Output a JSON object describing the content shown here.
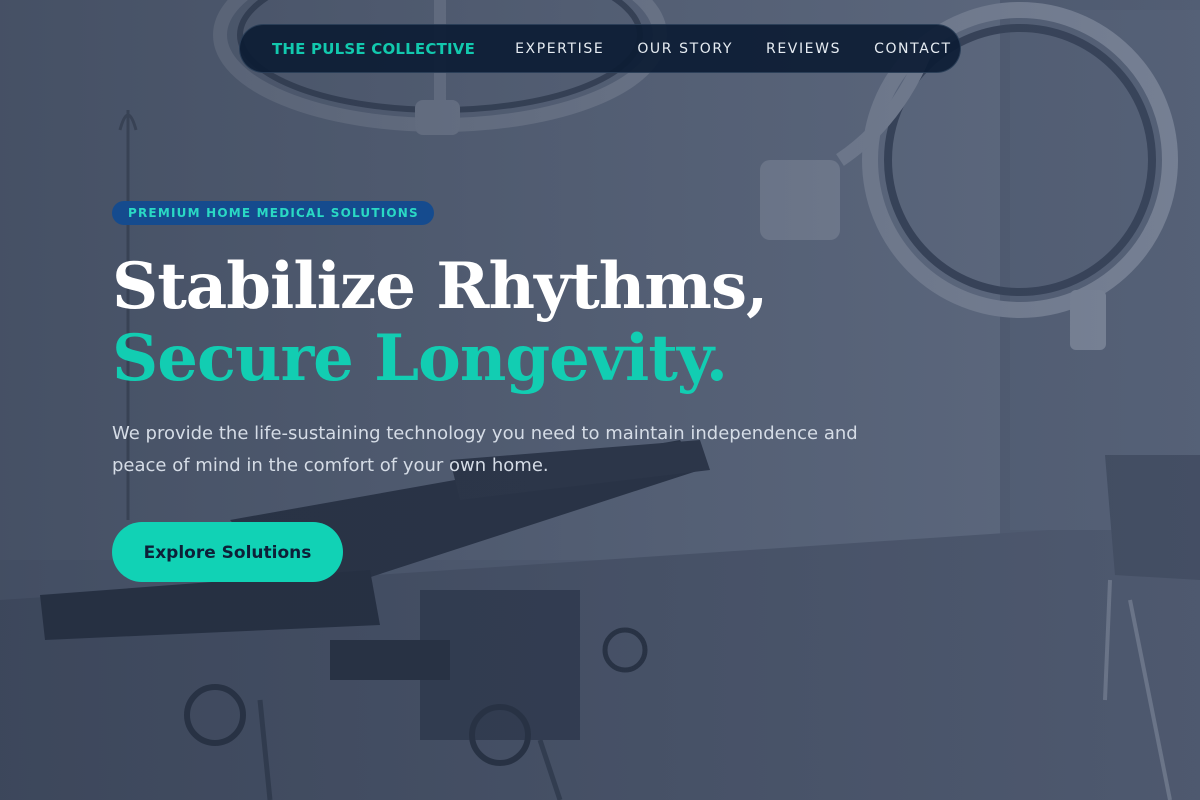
{
  "nav": {
    "brand": "THE PULSE COLLECTIVE",
    "links": [
      "EXPERTISE",
      "OUR STORY",
      "REVIEWS",
      "CONTACT"
    ]
  },
  "hero": {
    "badge": "PREMIUM HOME MEDICAL SOLUTIONS",
    "headline_line1": "Stabilize Rhythms,",
    "headline_line2": "Secure Longevity.",
    "subtext": "We provide the life-sustaining technology you need to maintain independence and peace of mind in the comfort of your own home.",
    "cta_label": "Explore Solutions"
  },
  "colors": {
    "accent": "#11d2b5",
    "nav_background": "#0c1c34",
    "badge_background": "#154b8e",
    "headline_white": "#ffffff"
  }
}
